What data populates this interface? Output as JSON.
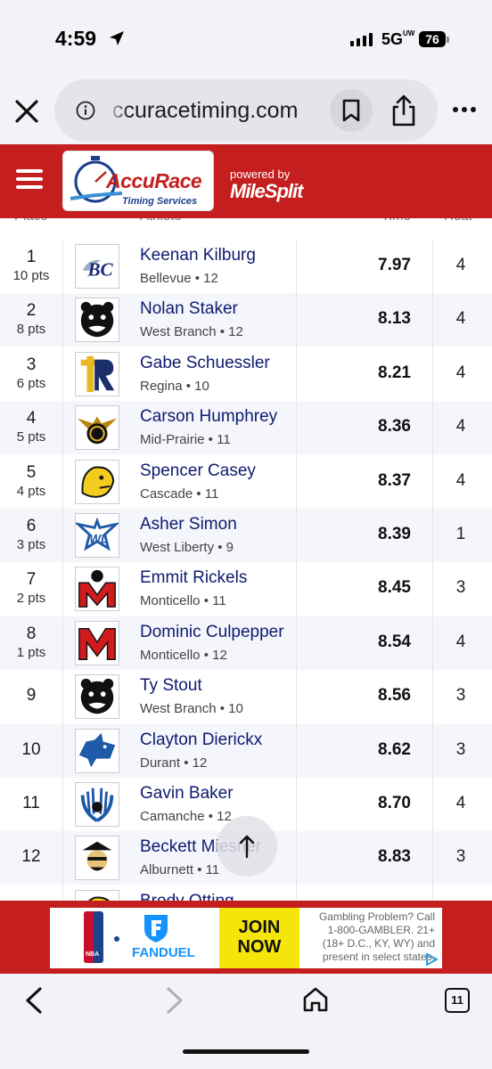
{
  "status": {
    "time": "4:59",
    "network": "5G",
    "network_sup": "UW",
    "battery": "76"
  },
  "browser": {
    "url": "ccuracetiming.com",
    "tab_count": "11"
  },
  "site": {
    "logo_text": "AccuRace",
    "logo_subtitle": "Timing Services",
    "powered_by": "powered by",
    "partner": "MileSplit"
  },
  "table": {
    "headers": {
      "place": "Place",
      "athlete": "Athlete",
      "time": "Time",
      "heat": "Heat"
    },
    "rows": [
      {
        "place": "1",
        "pts": "10 pts",
        "name": "Keenan Kilburg",
        "meta": "Bellevue • 12",
        "time": "7.97",
        "heat": "4"
      },
      {
        "place": "2",
        "pts": "8 pts",
        "name": "Nolan Staker",
        "meta": "West Branch • 12",
        "time": "8.13",
        "heat": "4"
      },
      {
        "place": "3",
        "pts": "6 pts",
        "name": "Gabe Schuessler",
        "meta": "Regina • 10",
        "time": "8.21",
        "heat": "4"
      },
      {
        "place": "4",
        "pts": "5 pts",
        "name": "Carson Humphrey",
        "meta": "Mid-Prairie • 11",
        "time": "8.36",
        "heat": "4"
      },
      {
        "place": "5",
        "pts": "4 pts",
        "name": "Spencer Casey",
        "meta": "Cascade • 11",
        "time": "8.37",
        "heat": "4"
      },
      {
        "place": "6",
        "pts": "3 pts",
        "name": "Asher Simon",
        "meta": "West Liberty • 9",
        "time": "8.39",
        "heat": "1"
      },
      {
        "place": "7",
        "pts": "2 pts",
        "name": "Emmit Rickels",
        "meta": "Monticello • 11",
        "time": "8.45",
        "heat": "3"
      },
      {
        "place": "8",
        "pts": "1 pts",
        "name": "Dominic Culpepper",
        "meta": "Monticello • 12",
        "time": "8.54",
        "heat": "4"
      },
      {
        "place": "9",
        "pts": "",
        "name": "Ty Stout",
        "meta": "West Branch • 10",
        "time": "8.56",
        "heat": "3"
      },
      {
        "place": "10",
        "pts": "",
        "name": "Clayton Dierickx",
        "meta": "Durant • 12",
        "time": "8.62",
        "heat": "3"
      },
      {
        "place": "11",
        "pts": "",
        "name": "Gavin Baker",
        "meta": "Camanche • 12",
        "time": "8.70",
        "heat": "4"
      },
      {
        "place": "12",
        "pts": "",
        "name": "Beckett Miesner",
        "meta": "Alburnett • 11",
        "time": "8.83",
        "heat": "3"
      },
      {
        "place": "",
        "pts": "",
        "name": "Brody Otting",
        "meta": "",
        "time": "",
        "heat": ""
      }
    ]
  },
  "ad": {
    "brand": "FANDUEL",
    "league": "NBA",
    "cta": "JOIN NOW",
    "disclaimer": "Gambling Problem? Call 1-800-GAMBLER. 21+ (18+ D.C., KY, WY) and present in select states."
  }
}
